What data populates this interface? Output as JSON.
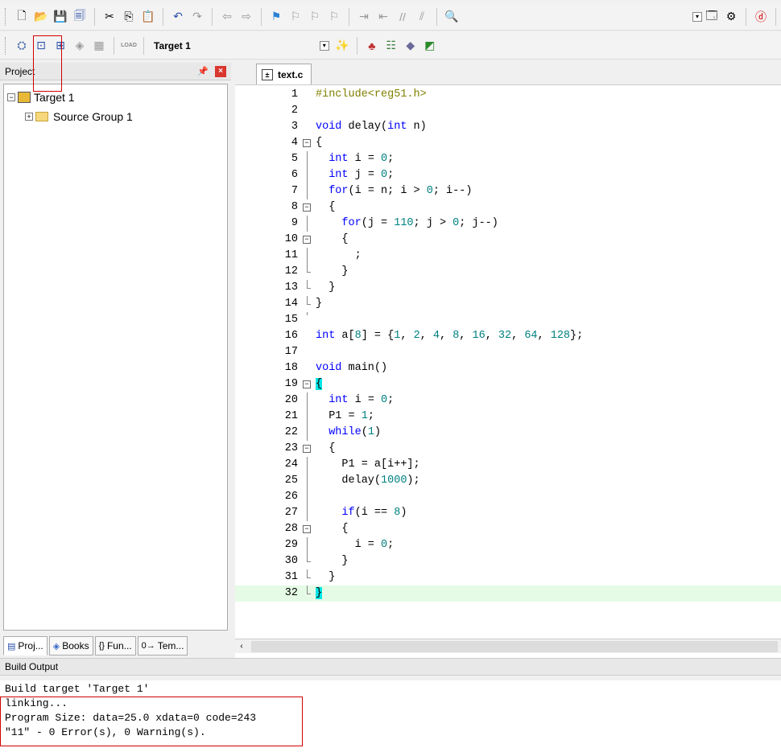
{
  "toolbar1": {
    "icons": [
      "new-file-icon",
      "open-file-icon",
      "save-icon",
      "save-all-icon",
      "cut-icon",
      "copy-icon",
      "paste-icon",
      "undo-icon",
      "redo-icon",
      "nav-back-icon",
      "nav-forward-icon",
      "bookmark-icon",
      "prev-bookmark-icon",
      "next-bookmark-icon",
      "clear-bookmarks-icon",
      "indent-icon",
      "unindent-icon",
      "comment-icon",
      "uncomment-icon",
      "find-in-files-icon",
      "select-window-icon",
      "debug-start-icon",
      "configure-icon"
    ]
  },
  "toolbar2": {
    "target_name": "Target 1",
    "load_label": "LOAD"
  },
  "project": {
    "title": "Project",
    "tree": {
      "root": "Target 1",
      "child": "Source Group 1"
    },
    "tabs": [
      "Proj...",
      "Books",
      "Fun...",
      "Tem..."
    ]
  },
  "editor": {
    "file_tab": "text.c",
    "lines": [
      {
        "n": "1",
        "html": "<span class='pp'>#include&lt;reg51.h&gt;</span>"
      },
      {
        "n": "2",
        "html": ""
      },
      {
        "n": "3",
        "html": "<span class='kw'>void</span> delay(<span class='kw'>int</span> n)"
      },
      {
        "n": "4",
        "html": "{"
      },
      {
        "n": "5",
        "html": "  <span class='kw'>int</span> i = <span class='num'>0</span>;"
      },
      {
        "n": "6",
        "html": "  <span class='kw'>int</span> j = <span class='num'>0</span>;"
      },
      {
        "n": "7",
        "html": "  <span class='kw'>for</span>(i = n; i &gt; <span class='num'>0</span>; i--)"
      },
      {
        "n": "8",
        "html": "  {"
      },
      {
        "n": "9",
        "html": "    <span class='kw'>for</span>(j = <span class='num'>110</span>; j &gt; <span class='num'>0</span>; j--)"
      },
      {
        "n": "10",
        "html": "    {"
      },
      {
        "n": "11",
        "html": "      ;"
      },
      {
        "n": "12",
        "html": "    }"
      },
      {
        "n": "13",
        "html": "  }"
      },
      {
        "n": "14",
        "html": "}"
      },
      {
        "n": "15",
        "html": ""
      },
      {
        "n": "16",
        "html": "<span class='kw'>int</span> a[<span class='num'>8</span>] = {<span class='num'>1</span>, <span class='num'>2</span>, <span class='num'>4</span>, <span class='num'>8</span>, <span class='num'>16</span>, <span class='num'>32</span>, <span class='num'>64</span>, <span class='num'>128</span>};"
      },
      {
        "n": "17",
        "html": ""
      },
      {
        "n": "18",
        "html": "<span class='kw'>void</span> main()"
      },
      {
        "n": "19",
        "html": "<span class='cursor-brace'>{</span>"
      },
      {
        "n": "20",
        "html": "  <span class='kw'>int</span> i = <span class='num'>0</span>;"
      },
      {
        "n": "21",
        "html": "  P1 = <span class='num'>1</span>;"
      },
      {
        "n": "22",
        "html": "  <span class='kw'>while</span>(<span class='num'>1</span>)"
      },
      {
        "n": "23",
        "html": "  {"
      },
      {
        "n": "24",
        "html": "    P1 = a[i++];"
      },
      {
        "n": "25",
        "html": "    delay(<span class='num'>1000</span>);"
      },
      {
        "n": "26",
        "html": ""
      },
      {
        "n": "27",
        "html": "    <span class='kw'>if</span>(i == <span class='num'>8</span>)"
      },
      {
        "n": "28",
        "html": "    {"
      },
      {
        "n": "29",
        "html": "      i = <span class='num'>0</span>;"
      },
      {
        "n": "30",
        "html": "    }"
      },
      {
        "n": "31",
        "html": "  }"
      },
      {
        "n": "32",
        "html": "<span class='cursor-brace'>}</span>"
      }
    ]
  },
  "build": {
    "title": "Build Output",
    "lines": [
      "Build target 'Target 1'",
      "linking...",
      "Program Size: data=25.0 xdata=0 code=243",
      "\"11\" - 0 Error(s), 0 Warning(s)."
    ]
  }
}
